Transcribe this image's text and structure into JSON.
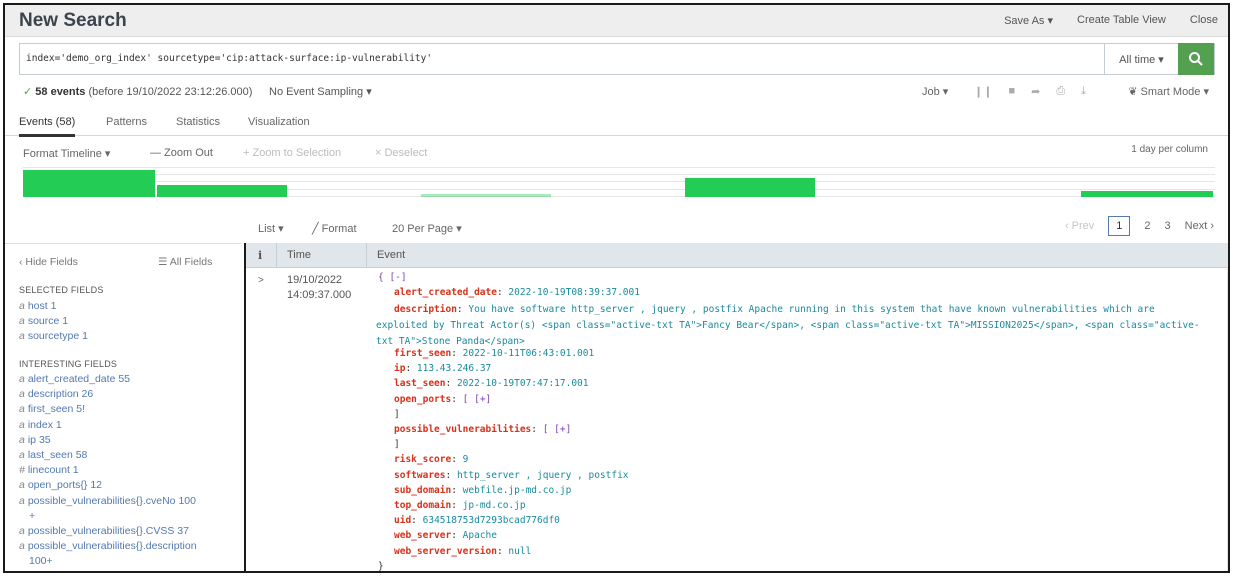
{
  "header": {
    "title": "New Search",
    "save_as": "Save As ▾",
    "create_table_view": "Create Table View",
    "close": "Close"
  },
  "search": {
    "query": "index='demo_org_index' sourcetype='cip:attack-surface:ip-vulnerability'",
    "time_range": "All time ▾",
    "submit_icon": "search-icon"
  },
  "status": {
    "check": "✓",
    "events_count": "58 events",
    "events_detail": " (before 19/10/2022 23:12:26.000)",
    "sampling": "No Event Sampling ▾",
    "job": "Job ▾",
    "job_icons": [
      "❙❙",
      "■",
      "➦",
      "⎙",
      "⤓"
    ],
    "mode": "❦ Smart Mode ▾"
  },
  "tabs": [
    "Events (58)",
    "Patterns",
    "Statistics",
    "Visualization"
  ],
  "timeline": {
    "format": "Format Timeline ▾",
    "zoom_out": "— Zoom Out",
    "zoom_selection": "+ Zoom to Selection",
    "deselect": "× Deselect",
    "scale": "1 day per column",
    "bar_color": "#22cc55"
  },
  "results": {
    "list": "List ▾",
    "format": "╱ Format",
    "per_page": "20 Per Page ▾",
    "prev": "‹ Prev",
    "pages": [
      "1",
      "2",
      "3"
    ],
    "next": "Next ›"
  },
  "sidebar": {
    "hide_fields": "‹ Hide Fields",
    "all_fields": "☰ All Fields",
    "selected_label": "SELECTED FIELDS",
    "selected": [
      {
        "type": "a",
        "name": "host",
        "count": "1"
      },
      {
        "type": "a",
        "name": "source",
        "count": "1"
      },
      {
        "type": "a",
        "name": "sourcetype",
        "count": "1"
      }
    ],
    "interesting_label": "INTERESTING FIELDS",
    "interesting": [
      {
        "type": "a",
        "name": "alert_created_date",
        "count": "55"
      },
      {
        "type": "a",
        "name": "description",
        "count": "26"
      },
      {
        "type": "a",
        "name": "first_seen",
        "count": "5!"
      },
      {
        "type": "a",
        "name": "index",
        "count": "1"
      },
      {
        "type": "a",
        "name": "ip",
        "count": "35"
      },
      {
        "type": "a",
        "name": "last_seen",
        "count": "58"
      },
      {
        "type": "#",
        "name": "linecount",
        "count": "1"
      },
      {
        "type": "a",
        "name": "open_ports{}",
        "count": "12"
      },
      {
        "type": "a",
        "name": "possible_vulnerabilities{}.cveNo",
        "count": "100"
      },
      {
        "type": "",
        "name": "+",
        "count": ""
      },
      {
        "type": "a",
        "name": "possible_vulnerabilities{}.CVSS",
        "count": "37"
      },
      {
        "type": "a",
        "name": "possible_vulnerabilities{}.description",
        "count": ""
      },
      {
        "type": "",
        "name": "100+",
        "count": ""
      }
    ]
  },
  "table": {
    "headers": [
      "i",
      "Time",
      "Event"
    ],
    "row": {
      "expand": ">",
      "date": "19/10/2022",
      "time": "14:09:37.000",
      "open": "{ [-]",
      "fields": [
        {
          "key": "alert_created_date",
          "value": "2022-10-19T08:39:37.001"
        },
        {
          "key": "description",
          "value": "You have software http_server , jquery , postfix Apache running in this system that have known vulnerabilities which are exploited by Threat Actor(s) <span class=\"active-txt TA\">Fancy Bear</span>, <span class=\"active-txt TA\">MISSION2025</span>, <span class=\"active-txt TA\">Stone Panda</span>"
        },
        {
          "key": "first_seen",
          "value": "2022-10-11T06:43:01.001"
        },
        {
          "key": "ip",
          "value": "113.43.246.37"
        },
        {
          "key": "last_seen",
          "value": "2022-10-19T07:47:17.001"
        },
        {
          "key": "open_ports",
          "value": "[ [+]"
        },
        {
          "key": "possible_vulnerabilities",
          "value": "[ [+]"
        },
        {
          "key": "risk_score",
          "value": "9"
        },
        {
          "key": "softwares",
          "value": "http_server , jquery , postfix"
        },
        {
          "key": "sub_domain",
          "value": "webfile.jp-md.co.jp"
        },
        {
          "key": "top_domain",
          "value": "jp-md.co.jp"
        },
        {
          "key": "uid",
          "value": "634518753d7293bcad776df0"
        },
        {
          "key": "web_server",
          "value": "Apache"
        },
        {
          "key": "web_server_version",
          "value": "null"
        }
      ],
      "close_bracket": "]",
      "close_brace": "}"
    }
  }
}
